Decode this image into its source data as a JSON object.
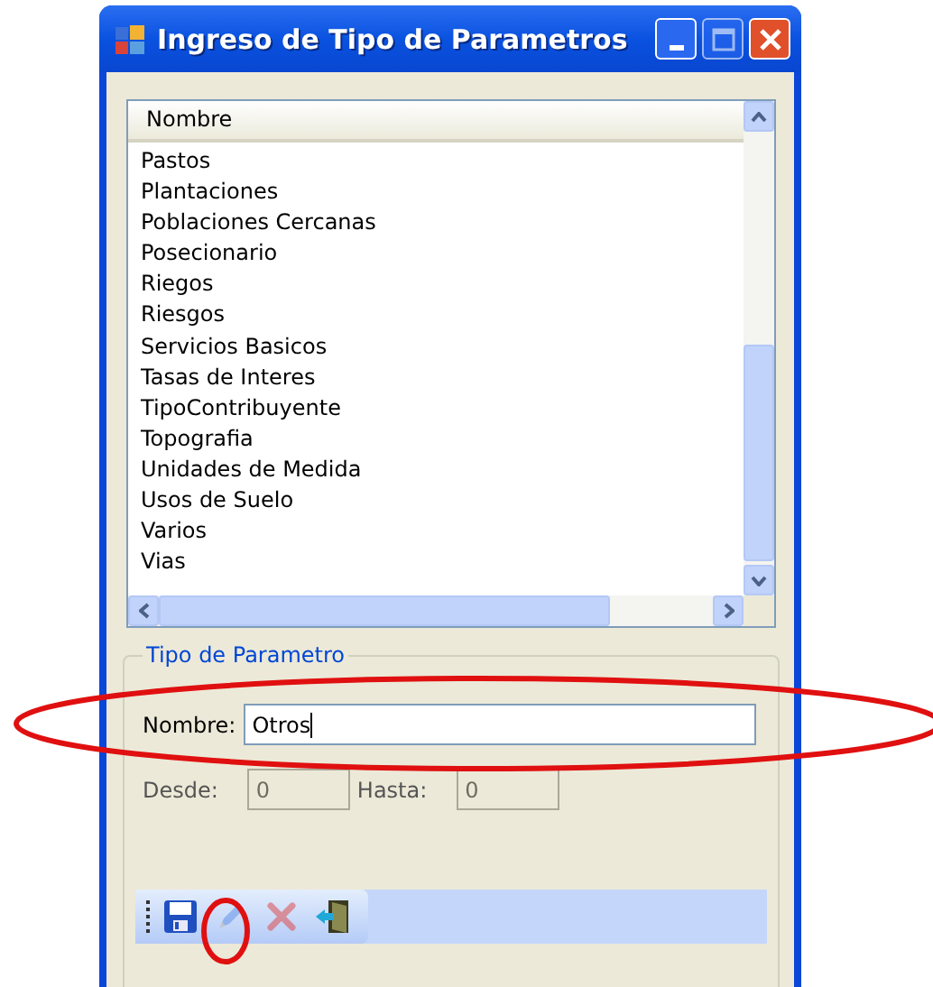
{
  "window": {
    "title": "Ingreso de Tipo de Parametros"
  },
  "list": {
    "column": "Nombre",
    "items": [
      "Pastos",
      "Plantaciones",
      "Poblaciones Cercanas",
      "Posecionario",
      "Riegos",
      "Riesgos",
      "Servicios Basicos",
      "Tasas de Interes",
      "TipoContribuyente",
      "Topografia",
      "Unidades de Medida",
      "Usos de Suelo",
      "Varios",
      "Vias"
    ]
  },
  "group": {
    "title": "Tipo de Parametro",
    "name_field": {
      "label": "Nombre:",
      "value": "Otros"
    },
    "range_fields": [
      {
        "label": "Desde:",
        "value": "0",
        "disabled": true
      },
      {
        "label": "Hasta:",
        "value": "0",
        "disabled": true
      }
    ]
  },
  "toolbar": [
    {
      "kind": "save",
      "disabled": false
    },
    {
      "kind": "edit",
      "disabled": true
    },
    {
      "kind": "delete",
      "disabled": true
    },
    {
      "kind": "exit",
      "disabled": false
    }
  ]
}
